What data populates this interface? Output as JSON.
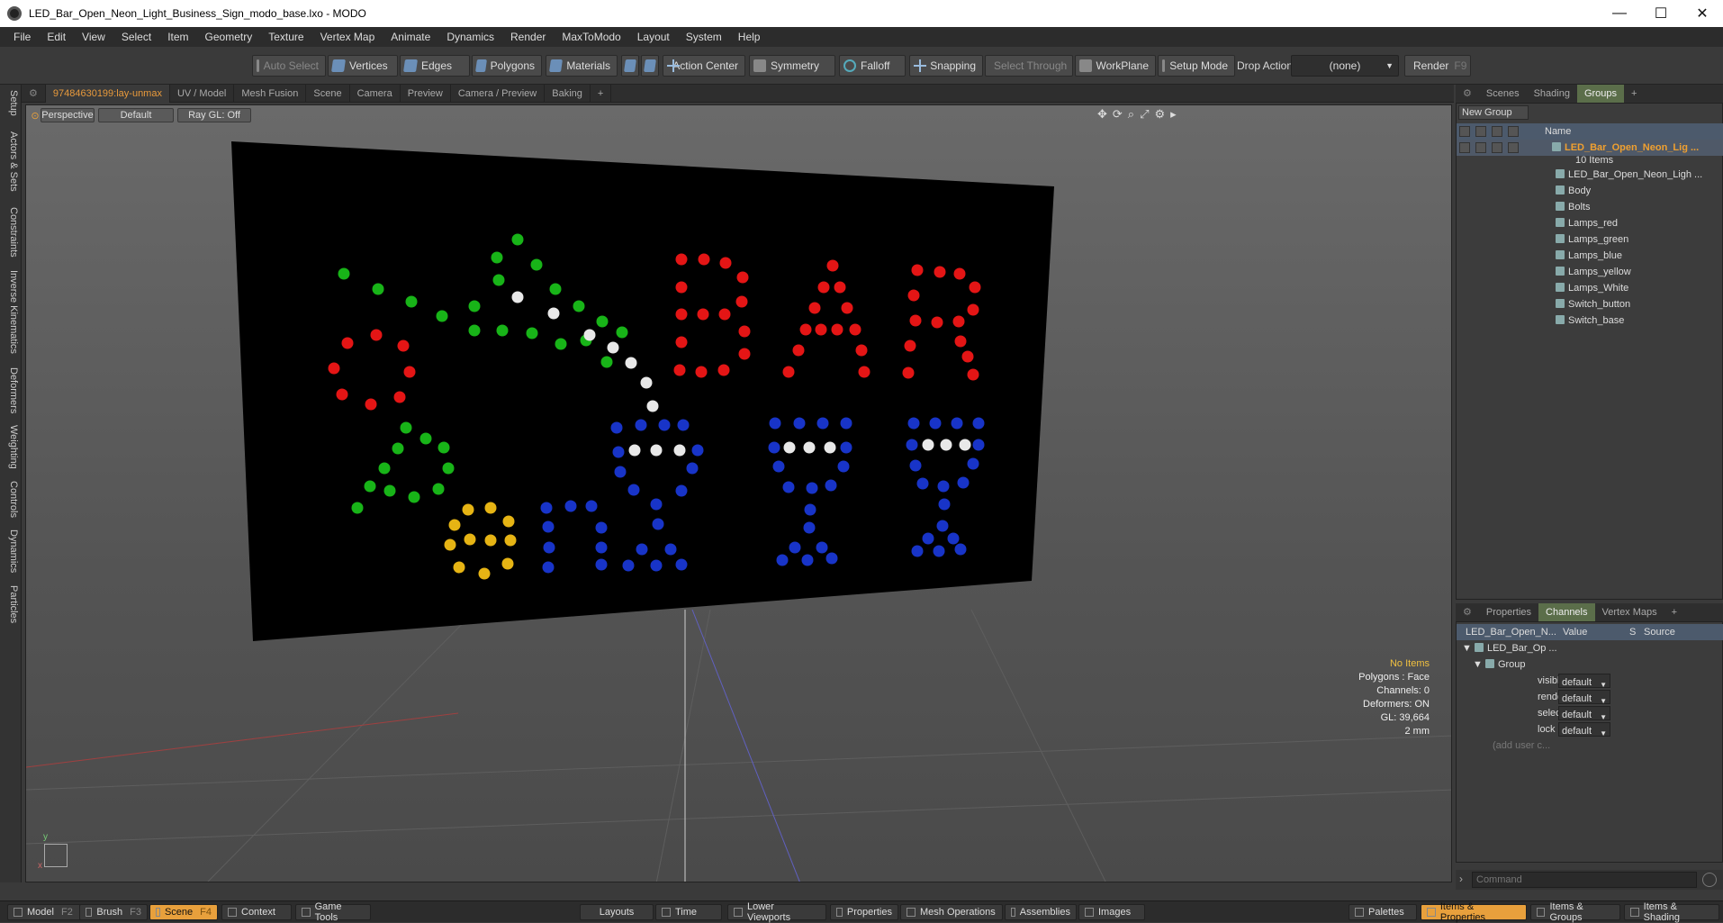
{
  "window": {
    "title": "LED_Bar_Open_Neon_Light_Business_Sign_modo_base.lxo - MODO",
    "minimize": "—",
    "maximize": "☐",
    "close": "✕"
  },
  "menu": [
    "File",
    "Edit",
    "View",
    "Select",
    "Item",
    "Geometry",
    "Texture",
    "Vertex Map",
    "Animate",
    "Dynamics",
    "Render",
    "MaxToModo",
    "Layout",
    "System",
    "Help"
  ],
  "toolbar": {
    "auto_select": "Auto Select",
    "vertices": "Vertices",
    "edges": "Edges",
    "polygons": "Polygons",
    "materials": "Materials",
    "action_center": "Action Center",
    "symmetry": "Symmetry",
    "falloff": "Falloff",
    "snapping": "Snapping",
    "select_through": "Select Through",
    "workplane": "WorkPlane",
    "setup_mode": "Setup Mode",
    "drop_action_label": "Drop Action",
    "drop_action_value": "(none)",
    "render": "Render",
    "render_key": "F9"
  },
  "left_tabs": [
    "Setup",
    "Actors & Sets",
    "Constraints",
    "Inverse Kinematics",
    "Deformers",
    "Weighting",
    "Controls",
    "Dynamics",
    "Particles"
  ],
  "viewport_tabs": [
    "97484630199:lay-unmax",
    "UV / Model",
    "Mesh Fusion",
    "Scene",
    "Camera",
    "Preview",
    "Camera / Preview",
    "Baking",
    "+"
  ],
  "viewport": {
    "perspective": "Perspective",
    "default": "Default",
    "raygl": "Ray GL: Off",
    "info": [
      "No Items",
      "Polygons : Face",
      "Channels: 0",
      "Deformers: ON",
      "GL: 39,664",
      "2 mm"
    ],
    "axis_y": "y",
    "axis_x": "x"
  },
  "right_tabs_top": [
    "Scenes",
    "Shading",
    "Groups",
    "+"
  ],
  "groups": {
    "new_group": "New Group",
    "name_header": "Name",
    "root_name": "LED_Bar_Open_Neon_Lig ...",
    "root_count": "10 Items",
    "items": [
      "LED_Bar_Open_Neon_Ligh ...",
      "Body",
      "Bolts",
      "Lamps_red",
      "Lamps_green",
      "Lamps_blue",
      "Lamps_yellow",
      "Lamps_White",
      "Switch_button",
      "Switch_base"
    ]
  },
  "right_tabs_bottom": [
    "Properties",
    "Channels",
    "Vertex Maps",
    "+"
  ],
  "channels": {
    "col_name": "LED_Bar_Open_N...",
    "col_value": "Value",
    "col_s": "S",
    "col_source": "Source",
    "root": "LED_Bar_Op ...",
    "group": "Group",
    "rows": [
      {
        "name": "visible",
        "value": "default"
      },
      {
        "name": "render",
        "value": "default"
      },
      {
        "name": "select",
        "value": "default"
      },
      {
        "name": "lock",
        "value": "default"
      }
    ],
    "add_user": "(add user c..."
  },
  "command_placeholder": "Command",
  "statusbar": {
    "model": "Model",
    "model_key": "F2",
    "brush": "Brush",
    "brush_key": "F3",
    "scene": "Scene",
    "scene_key": "F4",
    "context": "Context",
    "game_tools": "Game Tools",
    "layouts": "Layouts",
    "time": "Time",
    "lower_viewports": "Lower Viewports",
    "properties": "Properties",
    "mesh_operations": "Mesh Operations",
    "assemblies": "Assemblies",
    "images": "Images",
    "palettes": "Palettes",
    "items_properties": "Items & Properties",
    "items_groups": "Items & Groups",
    "items_shading": "Items & Shading"
  },
  "colors": {
    "accent": "#e8a03c",
    "led_red": "#e41515",
    "led_green": "#18b418",
    "led_blue": "#1834c8",
    "led_yellow": "#e6b414",
    "led_white": "#e8e8e8"
  }
}
